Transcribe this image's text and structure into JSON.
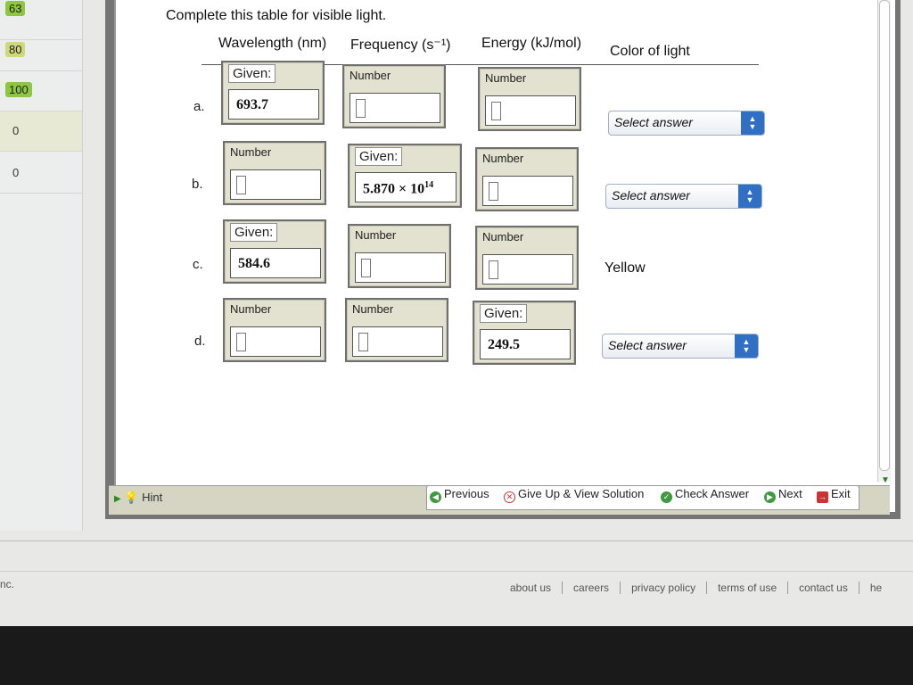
{
  "sidebar": {
    "scores": [
      {
        "value": "63",
        "color": "#8dc63f"
      },
      {
        "value": "80",
        "color": "#cfd977"
      },
      {
        "value": "100",
        "color": "#8dc63f"
      },
      {
        "value": "0",
        "color": ""
      },
      {
        "value": "0",
        "color": ""
      }
    ]
  },
  "question": {
    "instructions": "Complete this table for visible light.",
    "headers": {
      "wavelength": "Wavelength (nm)",
      "frequency": "Frequency (s⁻¹)",
      "energy": "Energy (kJ/mol)",
      "color": "Color of light"
    },
    "number_tag": "Number",
    "given_tag": "Given:",
    "select_placeholder": "Select answer",
    "rows": [
      {
        "label": "a.",
        "wavelength": "693.7"
      },
      {
        "label": "b.",
        "frequency_mantissa": "5.870 × 10",
        "frequency_exp": "14"
      },
      {
        "label": "c.",
        "wavelength": "584.6",
        "color": "Yellow"
      },
      {
        "label": "d.",
        "energy": "249.5"
      }
    ]
  },
  "toolbar": {
    "hint": "Hint",
    "previous": "Previous",
    "give_up": "Give Up & View Solution",
    "check": "Check Answer",
    "next": "Next",
    "exit": "Exit"
  },
  "footer": {
    "left_text": "nc.",
    "links": [
      "about us",
      "careers",
      "privacy policy",
      "terms of use",
      "contact us",
      "he"
    ]
  }
}
